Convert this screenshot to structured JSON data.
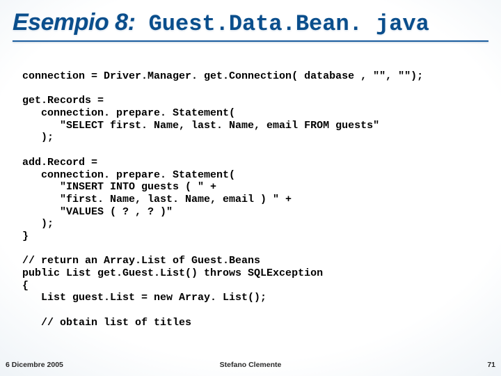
{
  "title": {
    "lead": "Esempio 8:",
    "tail": " Guest.Data.Bean. java"
  },
  "code": "connection = Driver.Manager. get.Connection( database , \"\", \"\");\n\nget.Records =\n   connection. prepare. Statement(\n      \"SELECT first. Name, last. Name, email FROM guests\"\n   );\n\nadd.Record =\n   connection. prepare. Statement(\n      \"INSERT INTO guests ( \" +\n      \"first. Name, last. Name, email ) \" +\n      \"VALUES ( ? , ? )\"\n   );\n}\n\n// return an Array.List of Guest.Beans\npublic List get.Guest.List() throws SQLException\n{\n   List guest.List = new Array. List();\n\n   // obtain list of titles",
  "footer": {
    "date": "6 Dicembre 2005",
    "author": "Stefano Clemente",
    "page": "71"
  }
}
